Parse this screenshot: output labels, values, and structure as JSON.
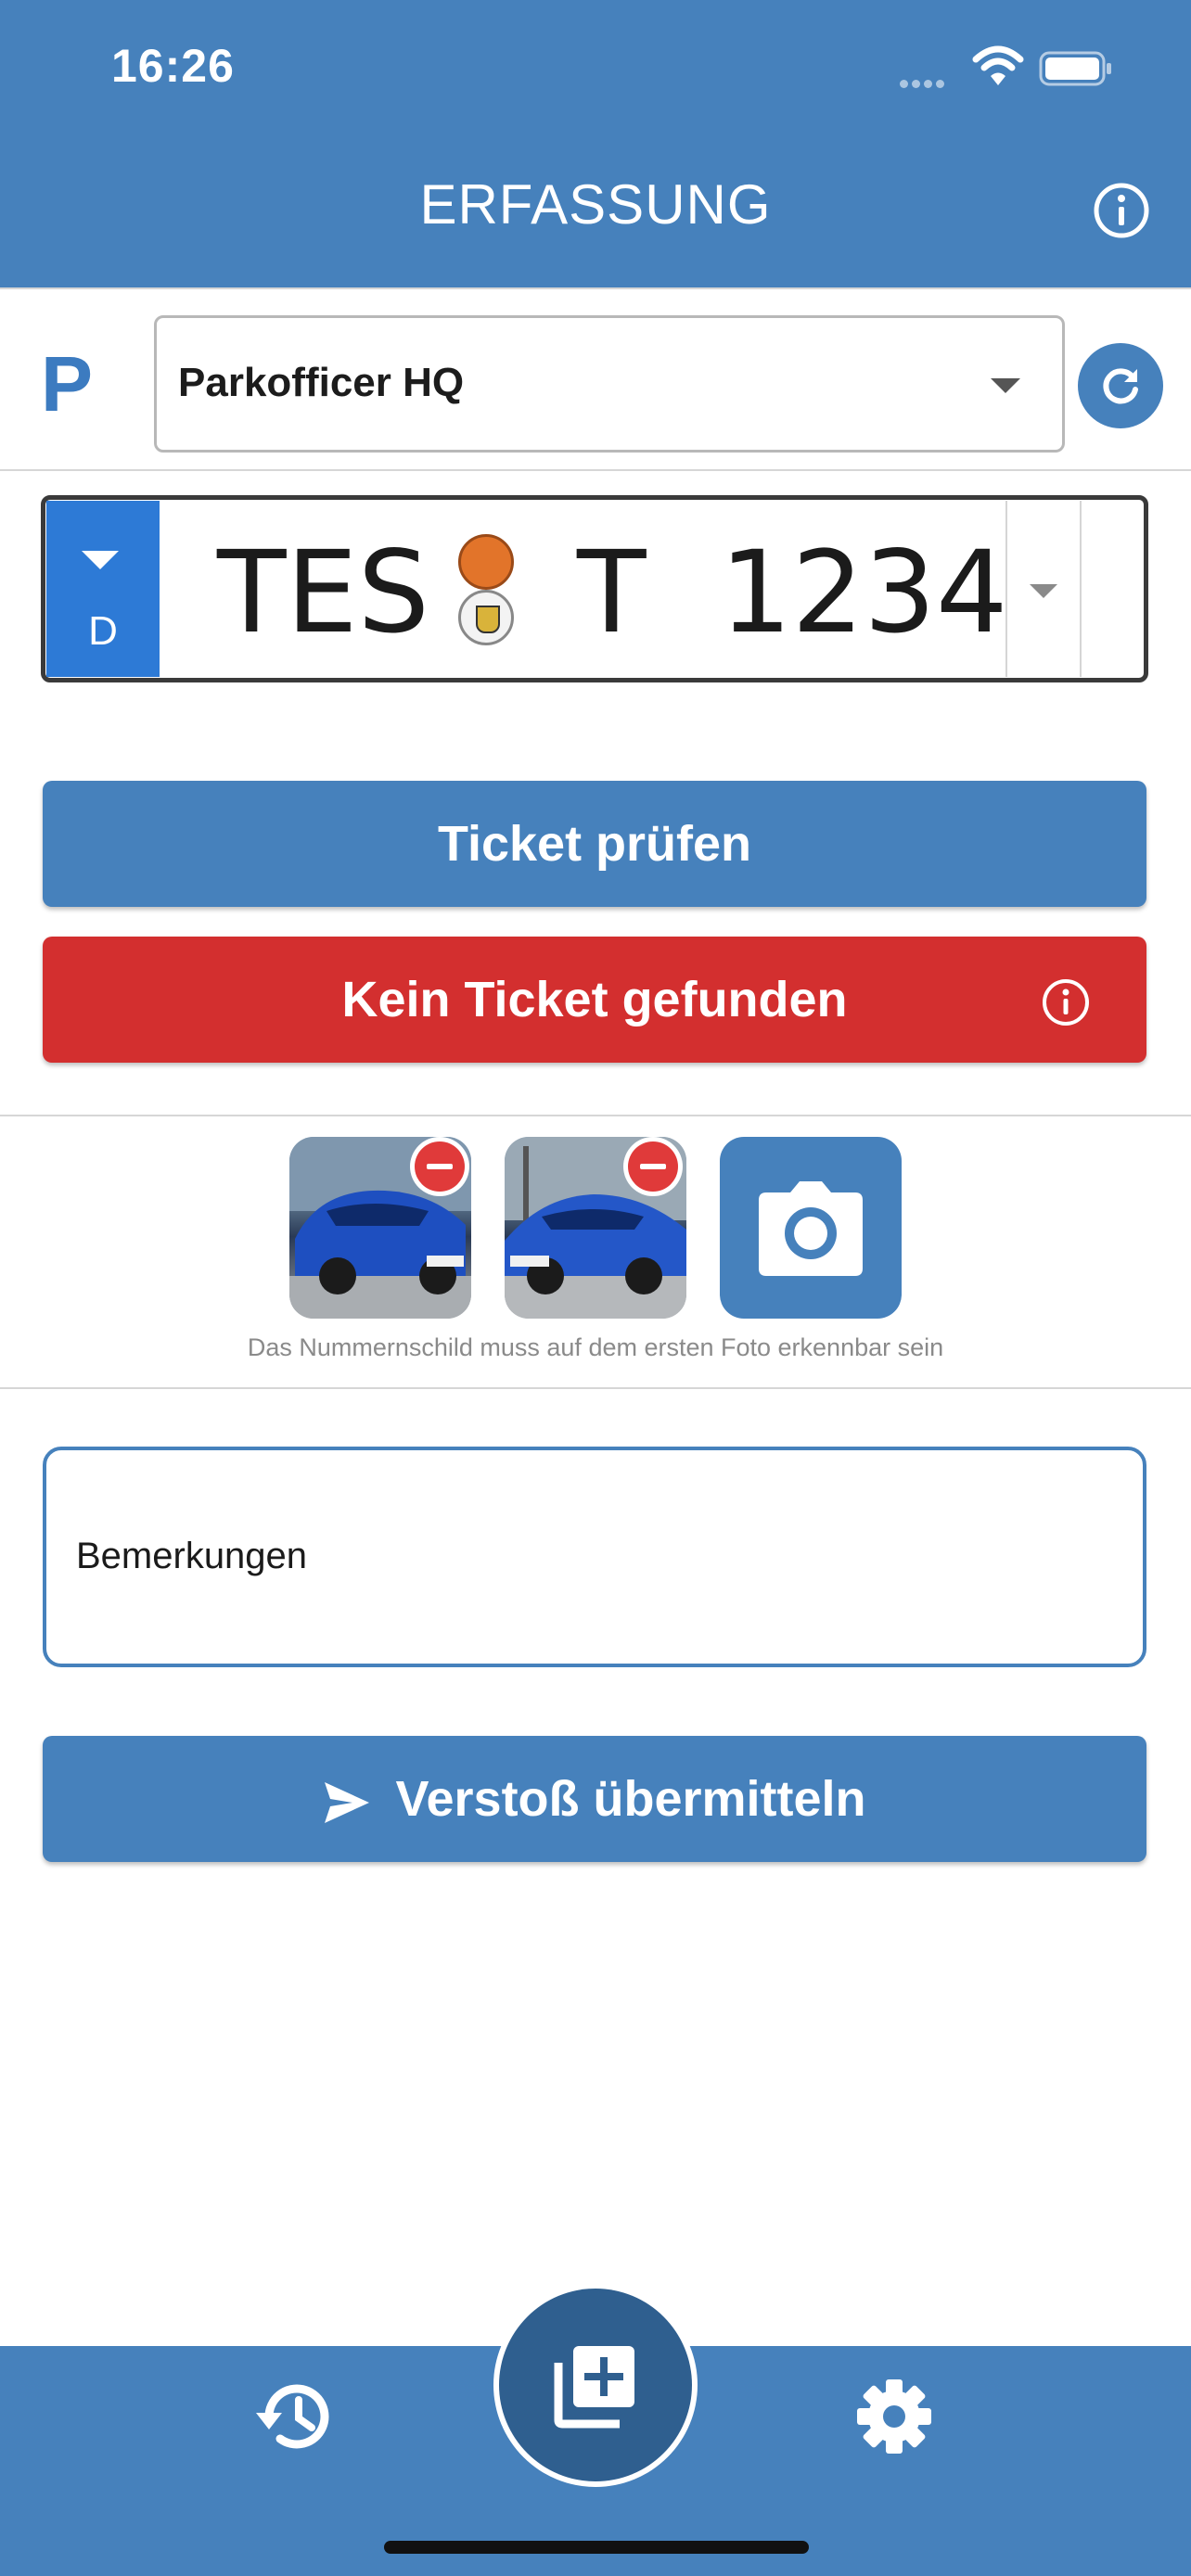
{
  "status_bar": {
    "time": "16:26"
  },
  "header": {
    "title": "ERFASSUNG",
    "info_icon": "info-icon"
  },
  "parking": {
    "logo": "P",
    "selected_location": "Parkofficer HQ",
    "refresh_icon": "refresh-icon"
  },
  "plate": {
    "country": "D",
    "district": "TES",
    "letters": "T",
    "number": "1234"
  },
  "actions": {
    "check_ticket_label": "Ticket prüfen",
    "status_label": "Kein Ticket gefunden",
    "submit_label": "Verstoß übermitteln"
  },
  "photos": {
    "hint": "Das Nummernschild muss auf dem ersten Foto erkennbar sein",
    "items": [
      {
        "name": "photo-1"
      },
      {
        "name": "photo-2"
      }
    ]
  },
  "remarks": {
    "placeholder": "Bemerkungen"
  },
  "colors": {
    "primary": "#4681BC",
    "danger": "#D32F2F",
    "plate_eu": "#2D7AD6",
    "fab": "#2F5F8F"
  }
}
